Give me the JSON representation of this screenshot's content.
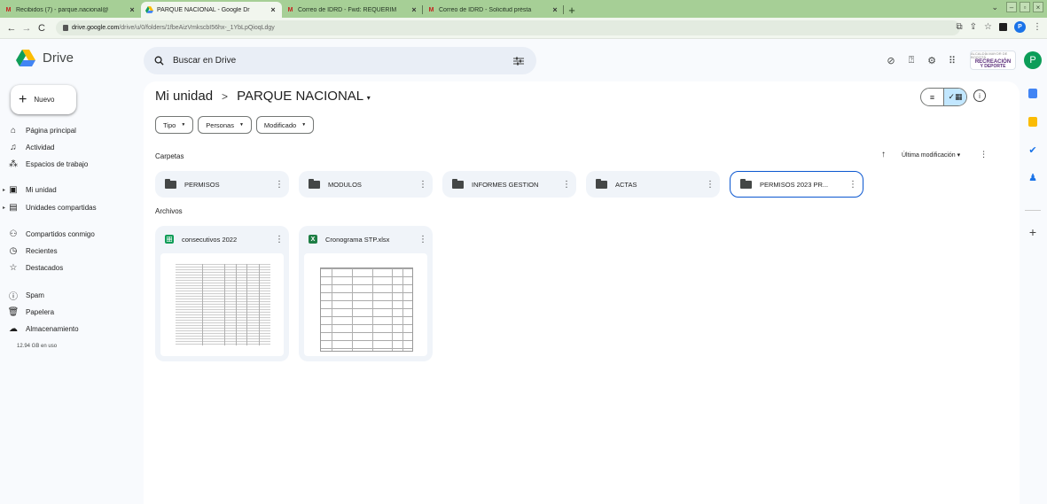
{
  "browser": {
    "tabs": [
      {
        "title": "Recibidos (7) - parque.nacional@",
        "favicon": "gmail-icon"
      },
      {
        "title": "PARQUE NACIONAL - Google Dr",
        "favicon": "drive-icon",
        "active": true
      },
      {
        "title": "Correo de IDRD - Fwd: REQUERIM",
        "favicon": "gmail-icon"
      },
      {
        "title": "Correo de IDRD - Solicitud présta",
        "favicon": "gmail-icon"
      }
    ],
    "url_host": "drive.google.com",
    "url_path": "/drive/u/0/folders/1fbeAizVmkscbI56hx-_1YbLpQioqLdgy"
  },
  "header": {
    "app_name": "Drive",
    "search_placeholder": "Buscar en Drive",
    "org_logo": {
      "line1": "ALCALDÍA MAYOR DE BOGOTÁ",
      "line2": "RECREACIÓN",
      "line3": "Y DEPORTE"
    },
    "avatar_letter": "P"
  },
  "sidebar": {
    "new_label": "Nuevo",
    "items": [
      {
        "label": "Página principal",
        "icon": "home-icon"
      },
      {
        "label": "Actividad",
        "icon": "bell-icon"
      },
      {
        "label": "Espacios de trabajo",
        "icon": "workspaces-icon"
      },
      {
        "label": "Mi unidad",
        "icon": "my-drive-icon"
      },
      {
        "label": "Unidades compartidas",
        "icon": "shared-drives-icon"
      },
      {
        "label": "Compartidos conmigo",
        "icon": "people-icon"
      },
      {
        "label": "Recientes",
        "icon": "clock-icon"
      },
      {
        "label": "Destacados",
        "icon": "star-icon"
      },
      {
        "label": "Spam",
        "icon": "spam-icon"
      },
      {
        "label": "Papelera",
        "icon": "trash-icon"
      },
      {
        "label": "Almacenamiento",
        "icon": "cloud-icon"
      }
    ],
    "storage_used": "12.94 GB en uso"
  },
  "main": {
    "breadcrumb_root": "Mi unidad",
    "breadcrumb_separator": ">",
    "breadcrumb_current": "PARQUE NACIONAL",
    "filters": [
      "Tipo",
      "Personas",
      "Modificado"
    ],
    "folders_label": "Carpetas",
    "files_label": "Archivos",
    "sort_label": "Última modificación",
    "folders": [
      "PERMISOS",
      "MODULOS",
      "INFORMES GESTION",
      "ACTAS",
      "PERMISOS 2023 PR..."
    ],
    "files": [
      {
        "name": "consecutivos 2022",
        "icon": "google-sheets-icon",
        "color": "#0f9d58"
      },
      {
        "name": "Cronograma STP.xlsx",
        "icon": "excel-icon",
        "color": "#1e7e45",
        "icon_text": "X"
      }
    ]
  },
  "colors": {
    "tabstrip": "#a6cf96",
    "accent": "#0b57d0",
    "selected_view": "#c2e7ff",
    "panel": "#f0f4f9"
  }
}
